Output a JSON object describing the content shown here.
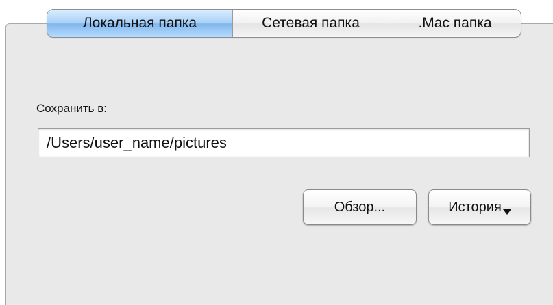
{
  "tabs": [
    {
      "label": "Локальная папка",
      "selected": true
    },
    {
      "label": "Сетевая папка",
      "selected": false
    },
    {
      "label": ".Mac папка",
      "selected": false
    }
  ],
  "save_location": {
    "label": "Сохранить в:",
    "path_value": "/Users/user_name/pictures"
  },
  "buttons": {
    "browse_label": "Обзор...",
    "history_label": "История"
  },
  "colors": {
    "selected_tab": "#a9d0f6",
    "panel_background": "#e9e9e9"
  },
  "icons": {
    "history_menu": "triangle-down-icon"
  }
}
